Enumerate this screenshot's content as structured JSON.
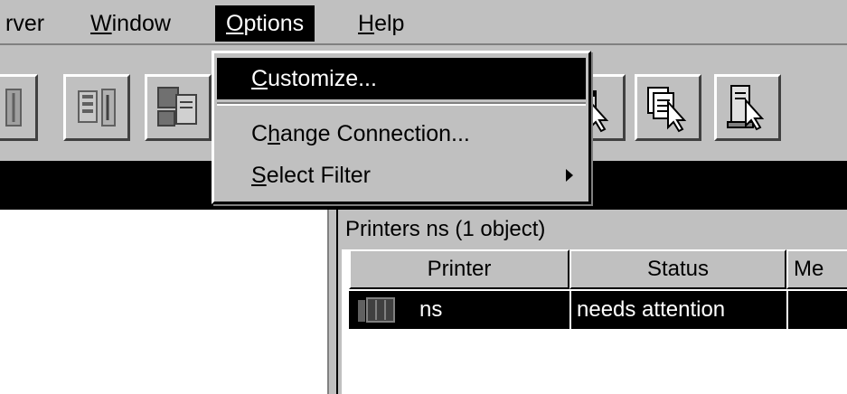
{
  "menubar": {
    "items": [
      {
        "label": "rver"
      },
      {
        "pre": "",
        "ul": "W",
        "post": "indow"
      },
      {
        "pre": "",
        "ul": "O",
        "post": "ptions"
      },
      {
        "pre": "",
        "ul": "H",
        "post": "elp"
      }
    ]
  },
  "toolbar": {
    "buttons": [
      {
        "icon": "property-icon"
      },
      {
        "icon": "copy-printer-icon"
      },
      {
        "icon": "move-document-icon"
      },
      {
        "icon": "select-window-icon"
      },
      {
        "icon": "select-document-icon"
      },
      {
        "icon": "select-server-icon"
      }
    ]
  },
  "options_menu": {
    "customize": {
      "pre": "",
      "ul": "C",
      "post": "ustomize..."
    },
    "change_connection": {
      "pre": "C",
      "ul": "h",
      "post": "ange Connection..."
    },
    "select_filter": {
      "pre": "",
      "ul": "S",
      "post": "elect Filter"
    },
    "submenu_arrow_icon": "triangle-right-icon"
  },
  "printers_pane": {
    "title": "Printers  ns  (1 object)",
    "columns": [
      "Printer",
      "Status",
      "Me"
    ],
    "rows": [
      {
        "icon": "printer-icon",
        "printer": "ns",
        "status": "needs attention",
        "message": ""
      }
    ]
  },
  "colors": {
    "face": "#c0c0c0",
    "highlight": "#000000",
    "highlight_text": "#ffffff"
  }
}
